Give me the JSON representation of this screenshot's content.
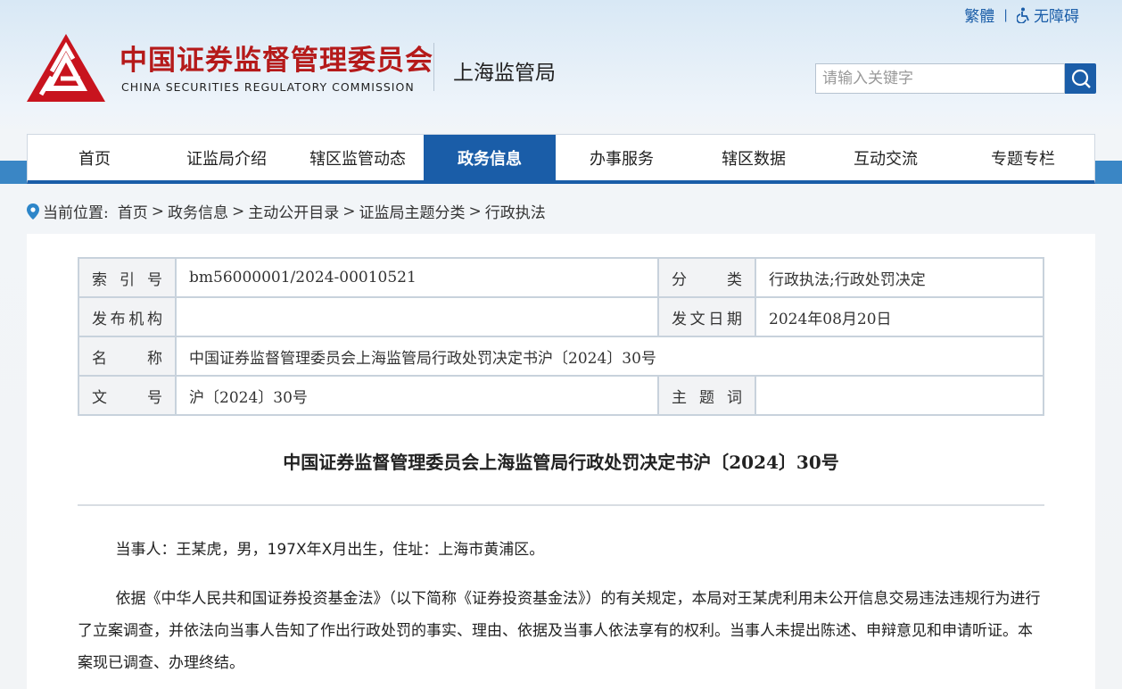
{
  "header": {
    "traditional_link": "繁體",
    "separator": "|",
    "accessibility_link": "无障碍",
    "org_name_cn": "中国证券监督管理委员会",
    "org_name_en": "CHINA SECURITIES REGULATORY COMMISSION",
    "sub_office": "上海监管局",
    "search_placeholder": "请输入关键字",
    "brand_color": "#b51a1a",
    "accent_color": "#1a5da8"
  },
  "nav": {
    "items": [
      {
        "label": "首页"
      },
      {
        "label": "证监局介绍"
      },
      {
        "label": "辖区监管动态"
      },
      {
        "label": "政务信息"
      },
      {
        "label": "办事服务"
      },
      {
        "label": "辖区数据"
      },
      {
        "label": "互动交流"
      },
      {
        "label": "专题专栏"
      }
    ],
    "active": "政务信息"
  },
  "breadcrumb": {
    "prefix": "当前位置:",
    "items": [
      "首页",
      "政务信息",
      "主动公开目录",
      "证监局主题分类",
      "行政执法"
    ],
    "sep": ">"
  },
  "meta": {
    "index_label": "索引号",
    "index_value": "bm56000001/2024-00010521",
    "category_label": "分类",
    "category_value": "行政执法;行政处罚决定",
    "publisher_label": "发布机构",
    "publisher_value": "",
    "date_label": "发文日期",
    "date_value": "2024年08月20日",
    "name_label": "名称",
    "name_value": "中国证券监督管理委员会上海监管局行政处罚决定书沪〔2024〕30号",
    "docno_label": "文号",
    "docno_value": "沪〔2024〕30号",
    "keyword_label": "主题词",
    "keyword_value": ""
  },
  "document": {
    "title": "中国证券监督管理委员会上海监管局行政处罚决定书沪〔2024〕30号",
    "para1": "当事人：王某虎，男，197X年X月出生，住址：上海市黄浦区。",
    "para2": "依据《中华人民共和国证券投资基金法》（以下简称《证券投资基金法》）的有关规定，本局对王某虎利用未公开信息交易违法违规行为进行了立案调查，并依法向当事人告知了作出行政处罚的事实、理由、依据及当事人依法享有的权利。当事人未提出陈述、申辩意见和申请听证。本案现已调查、办理终结。"
  }
}
